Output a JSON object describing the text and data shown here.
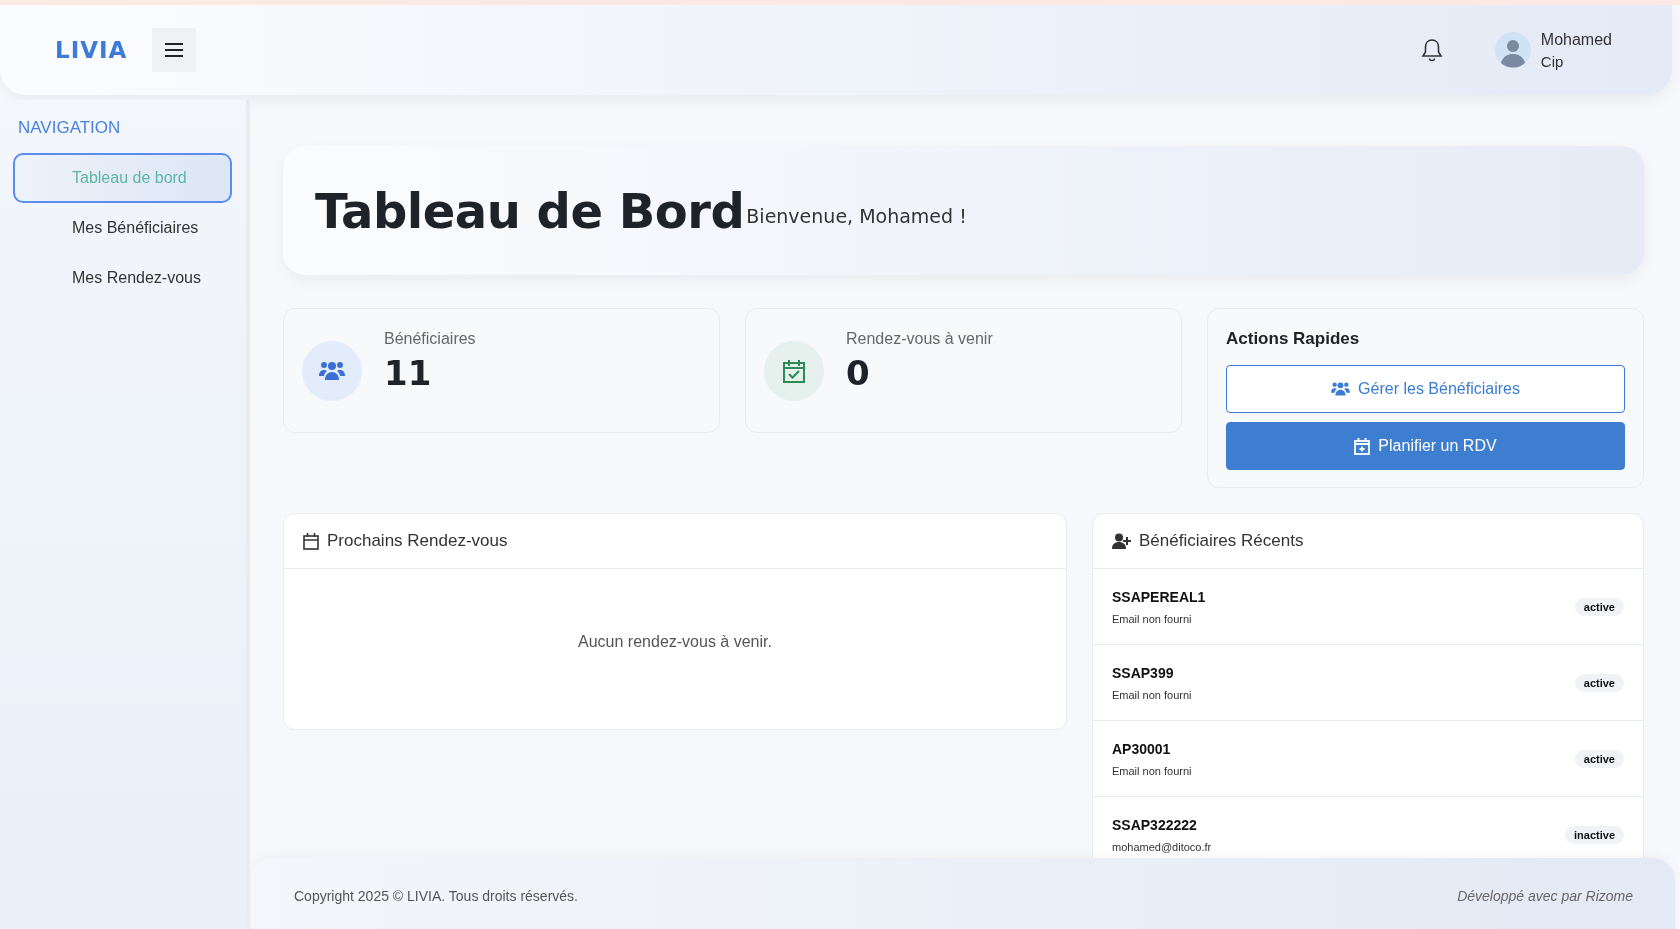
{
  "header": {
    "logo": "LIVIA",
    "user": {
      "name": "Mohamed",
      "role": "Cip"
    }
  },
  "sidebar": {
    "heading": "NAVIGATION",
    "items": [
      {
        "label": "Tableau de bord",
        "selected": true
      },
      {
        "label": "Mes Bénéficiaires",
        "selected": false
      },
      {
        "label": "Mes Rendez-vous",
        "selected": false
      }
    ]
  },
  "welcome": {
    "title": "Tableau de Bord",
    "greeting": "Bienvenue, Mohamed !"
  },
  "stats": [
    {
      "kind": "beneficiaries",
      "label": "Bénéficiaires",
      "value": "11"
    },
    {
      "kind": "appointments",
      "label": "Rendez-vous à venir",
      "value": "0"
    }
  ],
  "quick_actions": {
    "title": "Actions Rapides",
    "buttons": [
      {
        "kind": "outline",
        "label": "Gérer les Bénéficiaires"
      },
      {
        "kind": "primary",
        "label": "Planifier un RDV"
      }
    ]
  },
  "upcoming": {
    "title": "Prochains Rendez-vous",
    "empty": "Aucun rendez-vous à venir."
  },
  "recent": {
    "title": "Bénéficiaires Récents",
    "items": [
      {
        "name": "SSAPEREAL1",
        "email": "Email non fourni",
        "status": "active"
      },
      {
        "name": "SSAP399",
        "email": "Email non fourni",
        "status": "active"
      },
      {
        "name": "AP30001",
        "email": "Email non fourni",
        "status": "active"
      },
      {
        "name": "SSAP322222",
        "email": "mohamed@ditoco.fr",
        "status": "inactive"
      }
    ]
  },
  "footer": {
    "copyright": "Copyright 2025 © LIVIA. Tous droits réservés.",
    "credit": "Développé avec par Rizome"
  }
}
